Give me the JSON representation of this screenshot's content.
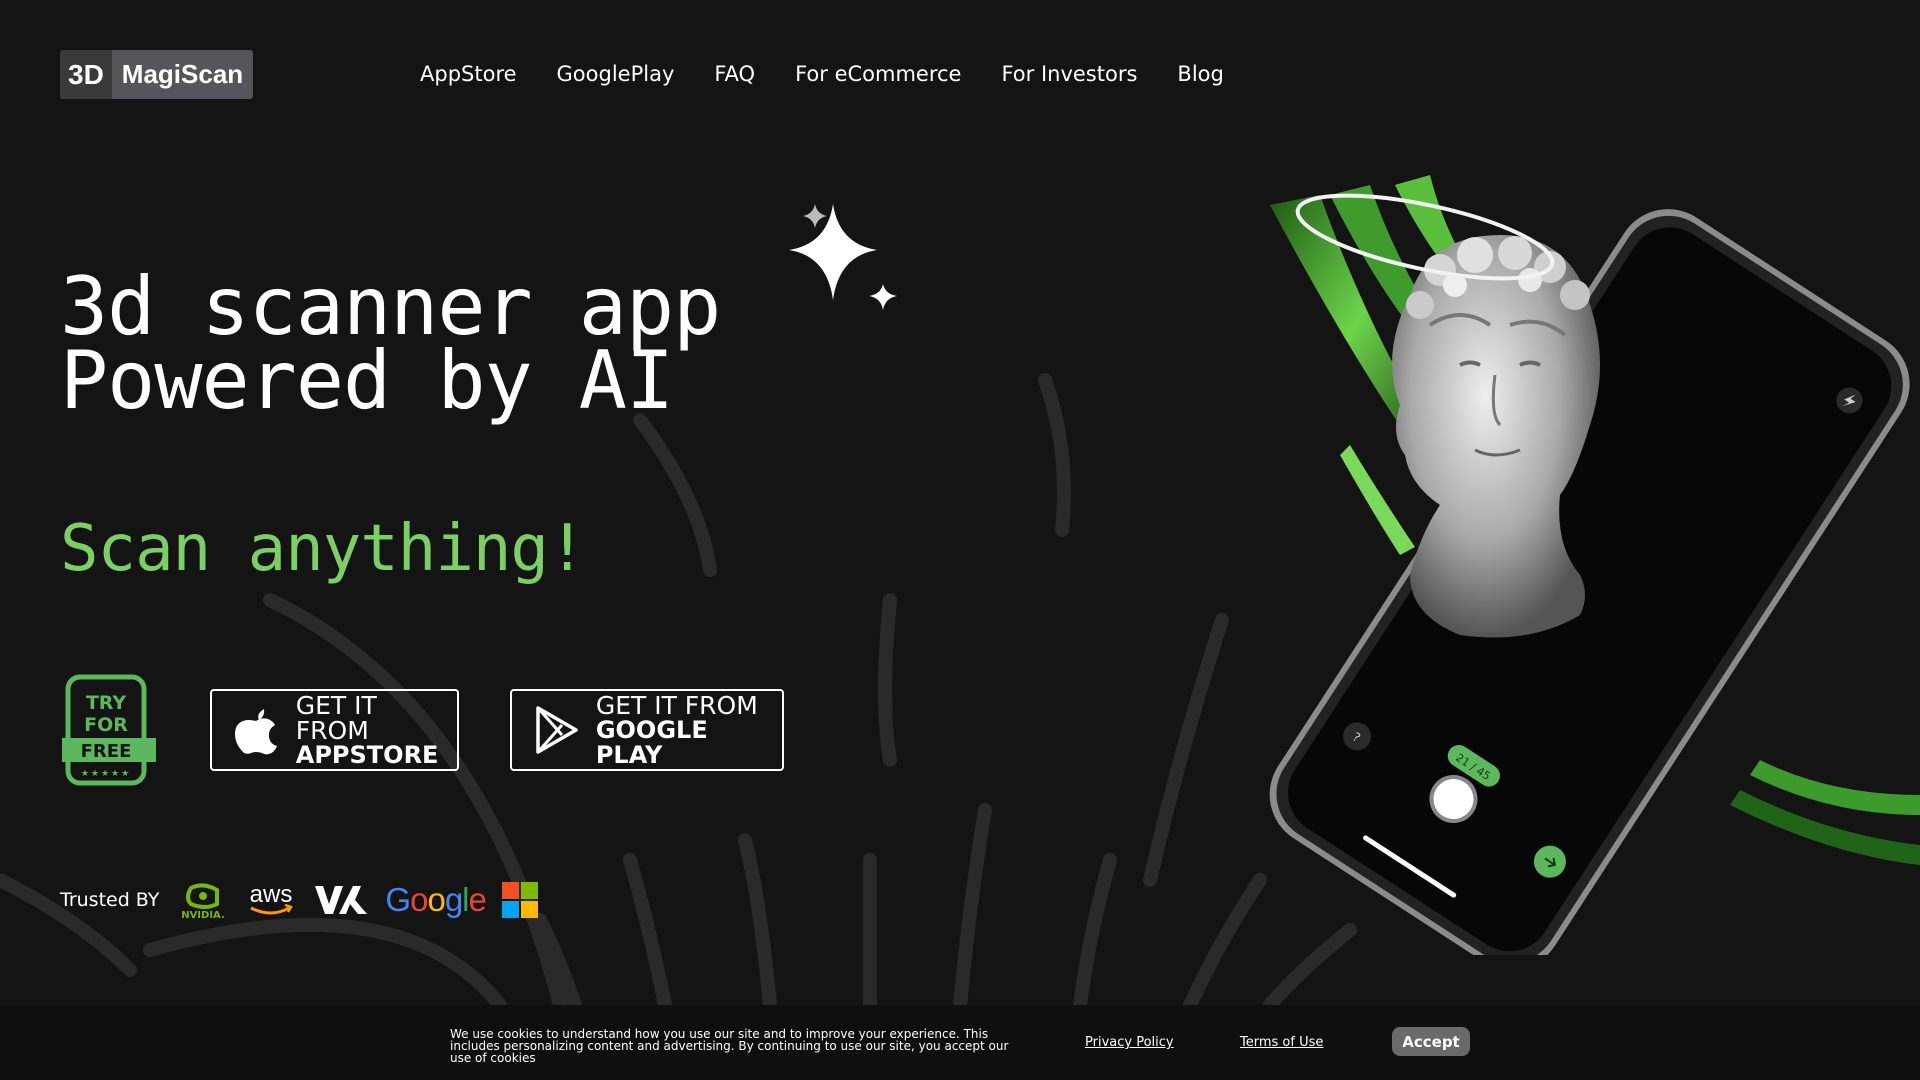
{
  "header": {
    "logo_prefix": "3D",
    "logo_name": "MagiScan",
    "nav": [
      "AppStore",
      "GooglePlay",
      "FAQ",
      "For eCommerce",
      "For Investors",
      "Blog"
    ]
  },
  "hero": {
    "headline_line1": "3d scanner app",
    "headline_line2": "Powered by AI",
    "tagline": "Scan anything!",
    "badge": {
      "line1": "TRY",
      "line2": "FOR",
      "line3": "FREE",
      "stars": "★★★★★"
    },
    "appstore": {
      "line1": "GET IT FROM",
      "line2": "APPSTORE"
    },
    "googleplay": {
      "line1": "GET IT FROM",
      "line2": "GOOGLE PLAY"
    }
  },
  "trusted": {
    "label": "Trusted BY",
    "logos": [
      "nvidia-logo",
      "aws-logo",
      "vk-logo",
      "google-logo",
      "microsoft-logo"
    ],
    "nvidia_text": "NVIDIA.",
    "aws_text": "aws",
    "google_letters": [
      "G",
      "o",
      "o",
      "g",
      "l",
      "e"
    ]
  },
  "phone": {
    "counter": "21 / 45",
    "help": "?",
    "flash_icon": "lightning-icon",
    "next_icon": "arrow-right-icon"
  },
  "cookie": {
    "text": "We use cookies to understand how you use our site and to improve your experience. This includes personalizing content and advertising. By continuing to use our site, you accept our use of cookies",
    "privacy": "Privacy Policy",
    "terms": "Terms of Use",
    "accept": "Accept"
  },
  "colors": {
    "background": "#141414",
    "accent_green": "#7ccf63",
    "badge_green": "#5cb85c",
    "cookie_bar": "#0f0f0f"
  }
}
